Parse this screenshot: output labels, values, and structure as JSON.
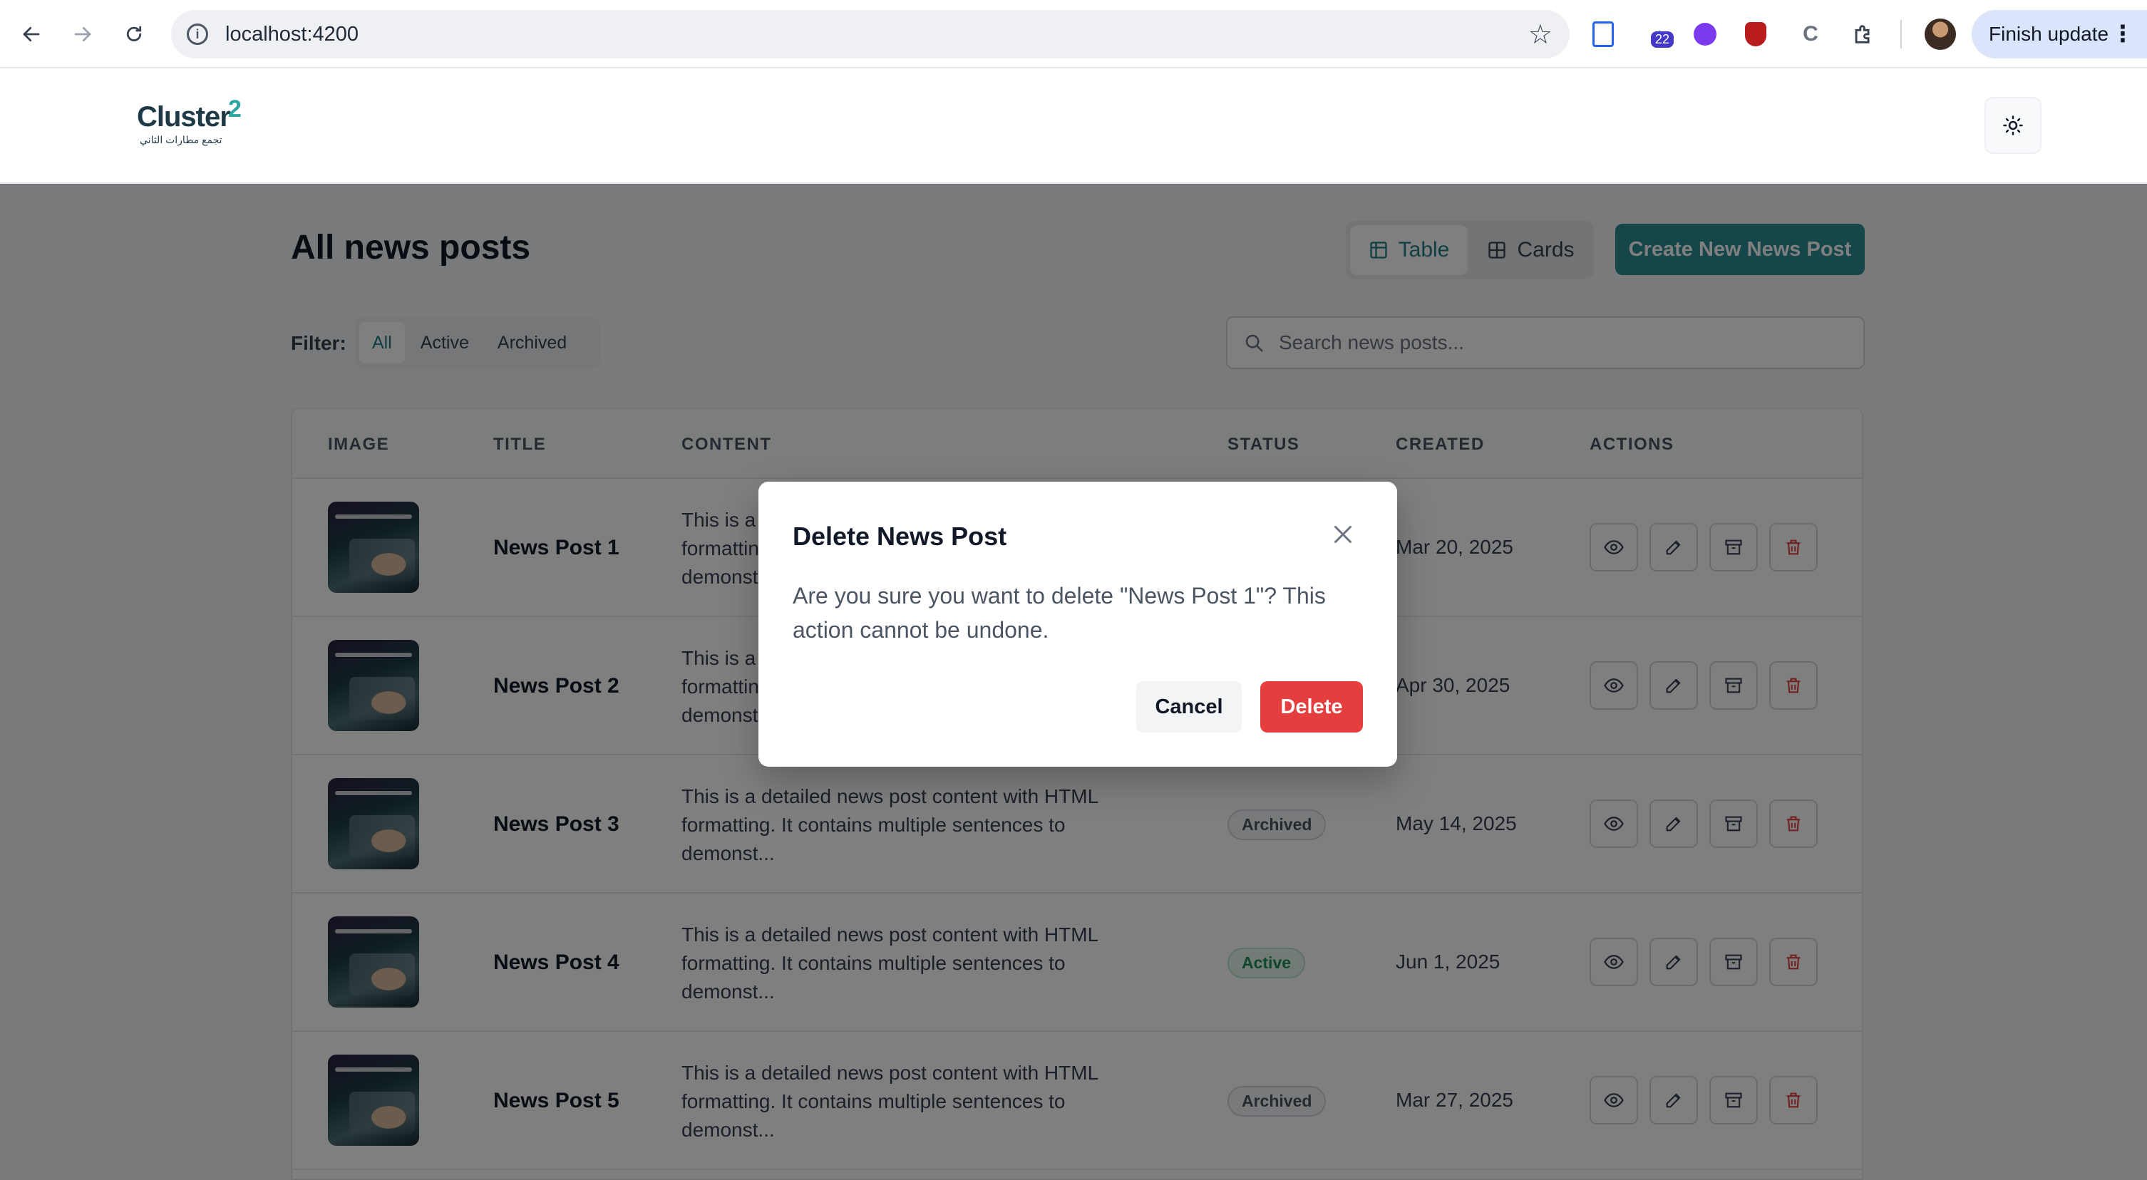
{
  "browser": {
    "url": "localhost:4200",
    "extension_badge": "22",
    "finish_update_label": "Finish update"
  },
  "header": {
    "logo_text": "Cluster",
    "logo_sup": "2",
    "logo_subtitle": "تجمع مطارات الثاني"
  },
  "page": {
    "title": "All news posts",
    "view_toggle": {
      "table_label": "Table",
      "cards_label": "Cards",
      "selected": "Table"
    },
    "create_button_label": "Create New News Post",
    "filter_label": "Filter:",
    "filters": [
      "All",
      "Active",
      "Archived"
    ],
    "selected_filter": "All",
    "search_placeholder": "Search news posts..."
  },
  "table": {
    "columns": [
      "IMAGE",
      "TITLE",
      "CONTENT",
      "STATUS",
      "CREATED",
      "ACTIONS"
    ],
    "rows": [
      {
        "title": "News Post 1",
        "content": "This is a detailed news post content with HTML formatting. It contains multiple sentences to demonst...",
        "status": "",
        "created": "Mar 20, 2025"
      },
      {
        "title": "News Post 2",
        "content": "This is a detailed news post content with HTML formatting. It contains multiple sentences to demonst...",
        "status": "",
        "created": "Apr 30, 2025"
      },
      {
        "title": "News Post 3",
        "content": "This is a detailed news post content with HTML formatting. It contains multiple sentences to demonst...",
        "status": "Archived",
        "created": "May 14, 2025"
      },
      {
        "title": "News Post 4",
        "content": "This is a detailed news post content with HTML formatting. It contains multiple sentences to demonst...",
        "status": "Active",
        "created": "Jun 1, 2025"
      },
      {
        "title": "News Post 5",
        "content": "This is a detailed news post content with HTML formatting. It contains multiple sentences to demonst...",
        "status": "Archived",
        "created": "Mar 27, 2025"
      }
    ]
  },
  "modal": {
    "title": "Delete News Post",
    "message": "Are you sure you want to delete \"News Post 1\"? This action cannot be undone.",
    "cancel_label": "Cancel",
    "delete_label": "Delete"
  },
  "colors": {
    "accent": "#2a8c94",
    "danger": "#e53e3e",
    "active_badge": "#1f8f5a"
  },
  "icons": [
    "back-icon",
    "forward-icon",
    "reload-icon",
    "info-icon",
    "star-icon",
    "sun-icon",
    "table-icon",
    "cards-icon",
    "search-icon",
    "eye-icon",
    "pencil-icon",
    "archive-icon",
    "trash-icon",
    "close-icon"
  ]
}
